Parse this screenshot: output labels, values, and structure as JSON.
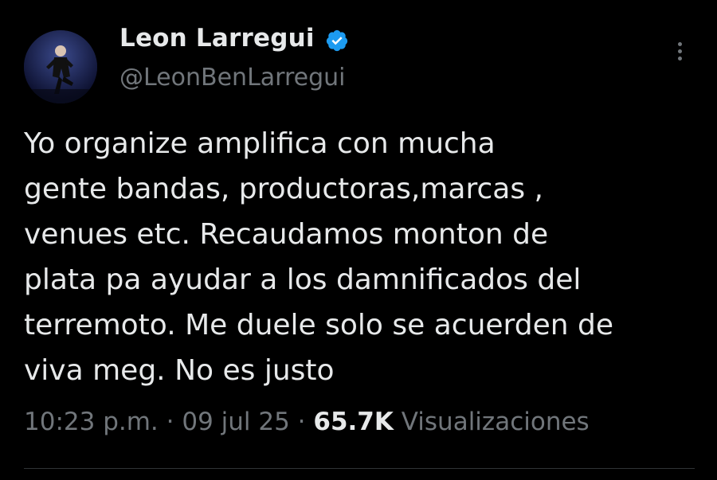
{
  "author": {
    "display_name": "Leon Larregui",
    "handle": "@LeonBenLarregui",
    "verified": true
  },
  "tweet": {
    "lines": [
      "Yo organize amplifica con mucha",
      "gente bandas, productoras,marcas ,",
      "venues etc. Recaudamos monton de",
      "plata pa ayudar a los damnificados del",
      "terremoto. Me duele solo se acuerden de",
      "viva meg. No es justo"
    ]
  },
  "meta": {
    "time": "10:23 p.m.",
    "separator": " · ",
    "date": "09 jul 25",
    "views_count": "65.7K",
    "views_label": "Visualizaciones"
  },
  "icons": {
    "verified": "verified-badge-icon",
    "more": "more-options-icon"
  },
  "colors": {
    "background": "#000000",
    "text": "#e7e9ea",
    "secondary": "#71767b",
    "verified": "#1d9bf0"
  }
}
